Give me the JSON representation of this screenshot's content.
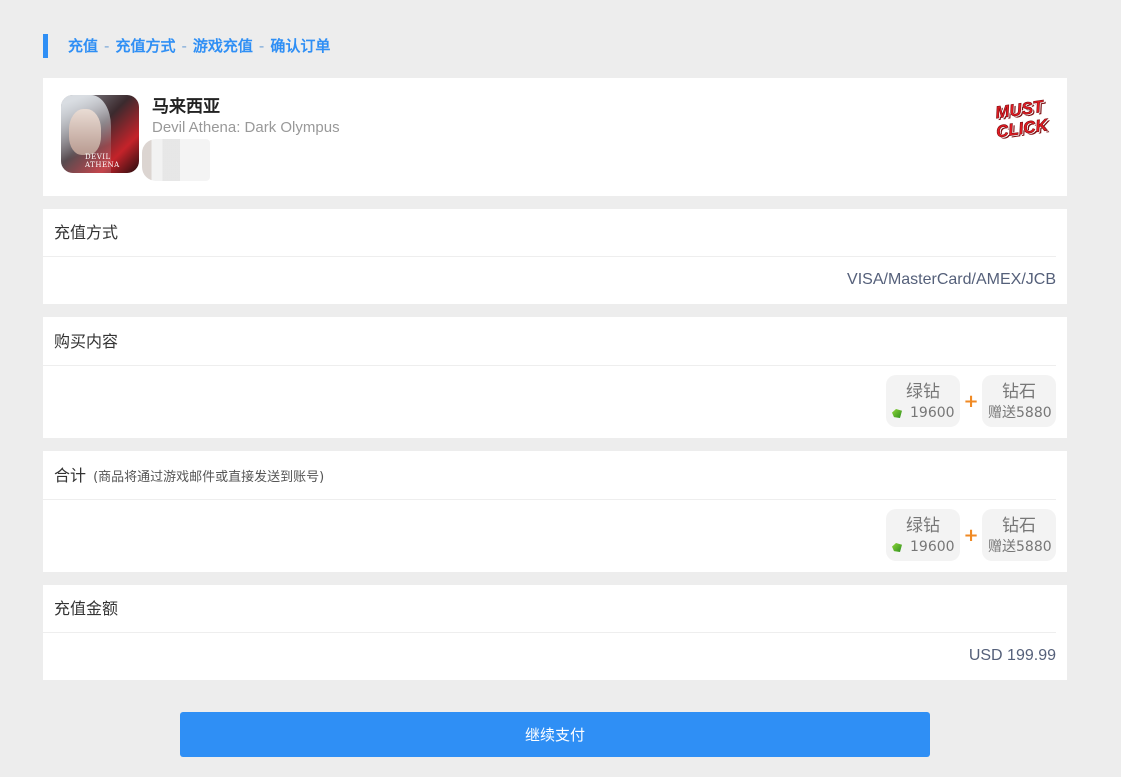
{
  "breadcrumb": {
    "items": [
      "充值",
      "充值方式",
      "游戏充值",
      "确认订单"
    ],
    "separator": "-"
  },
  "game": {
    "region": "马来西亚",
    "name": "Devil Athena: Dark Olympus",
    "icon_caption": "DEVIL ATHENA",
    "badge_line1": "MUST",
    "badge_line2": "CLICK"
  },
  "payment_method": {
    "title": "充值方式",
    "value": "VISA/MasterCard/AMEX/JCB"
  },
  "purchase": {
    "title": "购买内容",
    "item1_name": "绿钻",
    "item1_qty": "19600",
    "plus": "+",
    "item2_name": "钻石",
    "item2_qty": "赠送5880"
  },
  "total": {
    "title": "合计",
    "note": "(商品将通过游戏邮件或直接发送到账号)",
    "item1_name": "绿钻",
    "item1_qty": "19600",
    "plus": "+",
    "item2_name": "钻石",
    "item2_qty": "赠送5880"
  },
  "amount": {
    "title": "充值金额",
    "value": "USD 199.99"
  },
  "continue_button": "继续支付",
  "colors": {
    "accent": "#2f8ff5",
    "plus": "#f08a24",
    "badge": "#e31b23"
  }
}
